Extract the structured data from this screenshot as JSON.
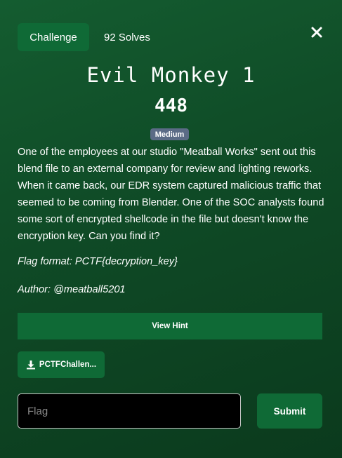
{
  "header": {
    "tab_label": "Challenge",
    "solves": "92 Solves",
    "close_icon": "close-icon"
  },
  "challenge": {
    "title": "Evil Monkey 1",
    "points": "448",
    "difficulty": "Medium",
    "description": "One of the employees at our studio \"Meatball Works\" sent out this blend file to an external company for review and lighting reworks. When it came back, our EDR system captured malicious traffic that seemed to be coming from Blender. One of the SOC analysts found some sort of encrypted shellcode in the file but doesn't know the encryption key. Can you find it?",
    "flag_format": "Flag format: PCTF{decryption_key}",
    "author": "Author: @meatball5201"
  },
  "actions": {
    "hint_label": "View Hint",
    "file_label": "PCTFChallen...",
    "file_icon": "download-icon",
    "flag_placeholder": "Flag",
    "flag_value": "",
    "submit_label": "Submit"
  },
  "colors": {
    "accent": "#0f6a36",
    "badge": "#5b6b86",
    "background": "#0f4a26"
  }
}
